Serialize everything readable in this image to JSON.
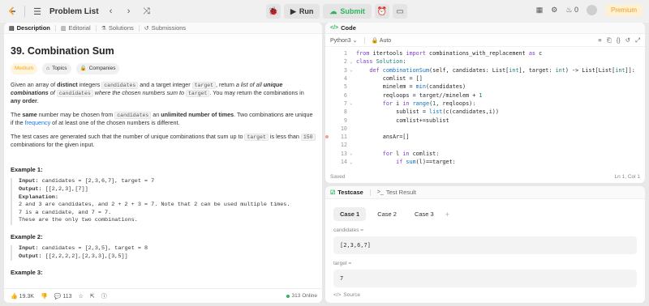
{
  "topbar": {
    "problem_list": "Problem List",
    "run": "Run",
    "submit": "Submit",
    "streak": "0",
    "premium": "Premium"
  },
  "desc": {
    "tabs": [
      "Description",
      "Editorial",
      "Solutions",
      "Submissions"
    ],
    "title": "39. Combination Sum",
    "difficulty": "Medium",
    "topics": "Topics",
    "companies": "Companies",
    "p1_a": "Given an array of ",
    "p1_b": "distinct",
    "p1_c": " integers ",
    "p1_code1": "candidates",
    "p1_d": " and a target integer ",
    "p1_code2": "target",
    "p1_e": ", return ",
    "p1_f": "a list of all ",
    "p1_g": "unique combinations",
    "p1_h": " of ",
    "p1_code3": "candidates",
    "p1_i": " where the chosen numbers sum to ",
    "p1_code4": "target",
    "p1_j": ". You may return the combinations in ",
    "p1_k": "any order",
    "p1_l": ".",
    "p2_a": "The ",
    "p2_b": "same",
    "p2_c": " number may be chosen from ",
    "p2_code": "candidates",
    "p2_d": " an ",
    "p2_e": "unlimited number of times",
    "p2_f": ". Two combinations are unique if the ",
    "p2_g": "frequency",
    "p2_h": " of at least one of the chosen numbers is different.",
    "p3_a": "The test cases are generated such that the number of unique combinations that sum up to ",
    "p3_code1": "target",
    "p3_b": " is less than ",
    "p3_code2": "150",
    "p3_c": " combinations for the given input.",
    "ex1_title": "Example 1:",
    "ex1_input_label": "Input:",
    "ex1_input": " candidates = [2,3,6,7], target = 7",
    "ex1_output_label": "Output:",
    "ex1_output": " [[2,2,3],[7]]",
    "ex1_expl_label": "Explanation:",
    "ex1_expl": "2 and 3 are candidates, and 2 + 2 + 3 = 7. Note that 2 can be used multiple times.\n7 is a candidate, and 7 = 7.\nThese are the only two combinations.",
    "ex2_title": "Example 2:",
    "ex2_input_label": "Input:",
    "ex2_input": " candidates = [2,3,5], target = 8",
    "ex2_output_label": "Output:",
    "ex2_output": " [[2,2,2,2],[2,3,3],[3,5]]",
    "ex3_title": "Example 3:",
    "likes": "19.3K",
    "comments": "113",
    "online": "313 Online"
  },
  "code": {
    "tab": "Code",
    "language": "Python3",
    "auto": "Auto",
    "saved": "Saved",
    "cursor": "Ln 1, Col 1",
    "lines": [
      {
        "n": "1",
        "html": "<span class='kw'>from</span> itertools <span class='kw'>import</span> combinations_with_replacement <span class='kw'>as</span> c"
      },
      {
        "n": "2",
        "html": "<span class='kw'>class</span> <span class='ty'>Solution</span>:"
      },
      {
        "n": "3",
        "html": "    <span class='kw'>def</span> <span class='fn'>combinationSum</span>(self, candidates: List[<span class='ty'>int</span>], target: <span class='ty'>int</span>) -> List[List[<span class='ty'>int</span>]]:"
      },
      {
        "n": "4",
        "html": "        comlist = []"
      },
      {
        "n": "5",
        "html": "        minelem = <span class='fn'>min</span>(candidates)"
      },
      {
        "n": "6",
        "html": "        reqloops = target//minelem + <span class='num'>1</span>"
      },
      {
        "n": "7",
        "html": "        <span class='kw'>for</span> i <span class='kw'>in</span> <span class='fn'>range</span>(<span class='num'>1</span>, reqloops):"
      },
      {
        "n": "8",
        "html": "            sublist = <span class='fn'>list</span>(c(candidates,i))"
      },
      {
        "n": "9",
        "html": "            comlist+=sublist"
      },
      {
        "n": "10",
        "html": ""
      },
      {
        "n": "11",
        "html": "        ansAr=[]"
      },
      {
        "n": "12",
        "html": ""
      },
      {
        "n": "13",
        "html": "        <span class='kw'>for</span> l <span class='kw'>in</span> comlist:"
      },
      {
        "n": "14",
        "html": "            <span class='kw'>if</span> <span class='fn'>sum</span>(l)==target:"
      }
    ]
  },
  "test": {
    "tab_testcase": "Testcase",
    "tab_result": "Test Result",
    "cases": [
      "Case 1",
      "Case 2",
      "Case 3"
    ],
    "label_candidates": "candidates =",
    "value_candidates": "[2,3,6,7]",
    "label_target": "target =",
    "value_target": "7",
    "source": "Source"
  }
}
